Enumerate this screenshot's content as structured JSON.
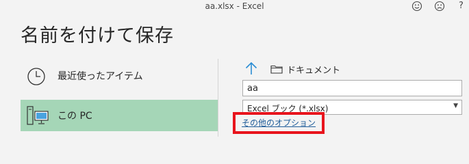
{
  "window": {
    "title": "aa.xlsx  -  Excel",
    "icons": [
      "smile-icon",
      "frown-icon"
    ],
    "help_label": "?"
  },
  "page": {
    "title": "名前を付けて保存"
  },
  "locations": [
    {
      "label": "最近使ったアイテム",
      "icon": "clock-icon",
      "selected": false
    },
    {
      "label": "この PC",
      "icon": "computer-icon",
      "selected": true
    }
  ],
  "save": {
    "breadcrumb": "ドキュメント",
    "filename": "aa",
    "filetype": "Excel ブック (*.xlsx)",
    "more_options": "その他のオプション"
  },
  "colors": {
    "selected_background": "#a5d6b7",
    "accent_arrow": "#2a8dd4",
    "link": "#1f5c99",
    "annotation_border": "#e8141c"
  }
}
